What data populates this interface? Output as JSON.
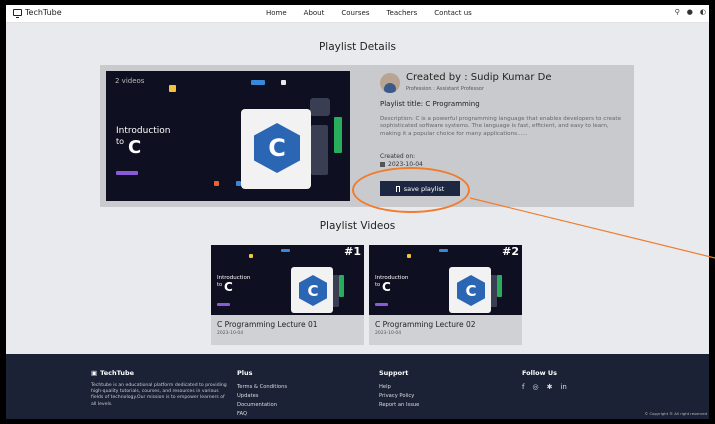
{
  "nav": {
    "brand": "TechTube",
    "links": [
      "Home",
      "About",
      "Courses",
      "Teachers",
      "Contact us"
    ],
    "icons": [
      "search-icon",
      "user-icon",
      "theme-icon"
    ]
  },
  "details": {
    "heading": "Playlist Details",
    "video_count": "2 videos",
    "thumb_intro": "Introduction",
    "thumb_to": "to",
    "thumb_c": "C",
    "creator": "Created by : Sudip Kumar De",
    "profession": "Profession : Assistant Professor",
    "playlist_title": "Playlist title: C Programming",
    "description": "Description: C is a powerful programming language that enables developers to create sophisticated software systems. The language is fast, efficient, and easy to learn, making it a popular choice for many applications......",
    "created_label": "Created on:",
    "created_date": "2023-10-04",
    "save_label": "save playlist"
  },
  "videos": {
    "heading": "Playlist Videos",
    "items": [
      {
        "num": "#1",
        "title": "C Programming Lecture 01",
        "date": "2023-10-04",
        "intro": "Introduction",
        "to": "to",
        "c": "C"
      },
      {
        "num": "#2",
        "title": "C Programming Lecture 02",
        "date": "2023-10-04",
        "intro": "Introduction",
        "to": "to",
        "c": "C"
      }
    ]
  },
  "footer": {
    "brand": "TechTube",
    "about": "Techtube is an educational platform dedicated to providing high-quality tutorials, courses, and resources in various fields of technology.Our mission is to empower learners of all levels.",
    "plus_title": "Plus",
    "plus_links": [
      "Terms & Conditions",
      "Updates",
      "Documentation",
      "FAQ"
    ],
    "support_title": "Support",
    "support_links": [
      "Help",
      "Privacy Policy",
      "Report an Issue"
    ],
    "follow_title": "Follow Us",
    "social_icons": [
      "facebook-icon",
      "instagram-icon",
      "twitter-icon",
      "linkedin-icon"
    ],
    "copyright": "© Copyright ® All right reserved"
  },
  "colors": {
    "page_bg": "#e9eaed",
    "card_bg": "#c9cacd",
    "button_bg": "#1e2742",
    "footer_bg": "#1b2236",
    "annotation": "#f07c2e"
  }
}
